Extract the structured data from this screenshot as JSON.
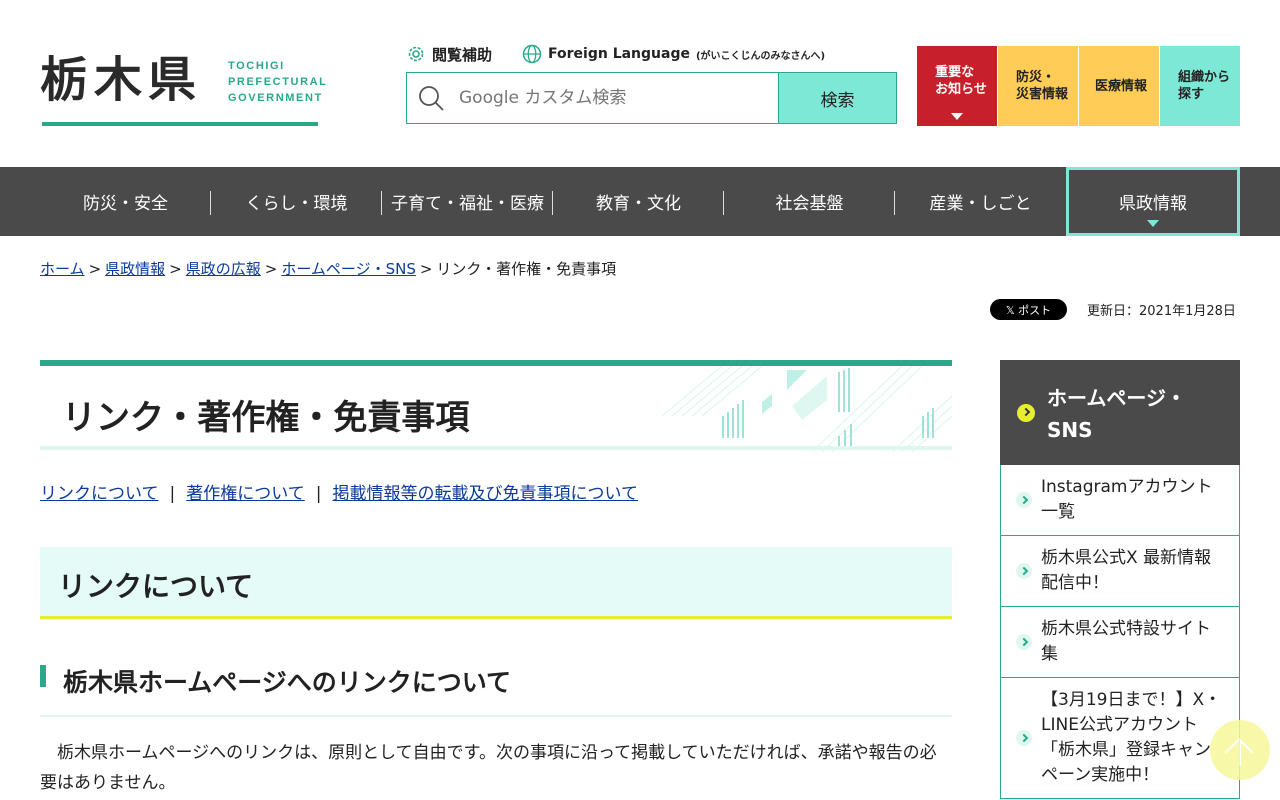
{
  "header": {
    "logo_kanji": "栃木県",
    "logo_en_lines": [
      "TOCHIGI",
      "PREFECTURAL",
      "GOVERNMENT"
    ],
    "tools": {
      "assist_label": "閲覧補助",
      "lang_label": "Foreign Language",
      "lang_sub": "(がいこくじんのみなさんへ)"
    },
    "search": {
      "placeholder": "Google カスタム検索",
      "button_label": "検索"
    },
    "quick_links": [
      {
        "label": "重要な\nお知らせ",
        "color": "#c8202a"
      },
      {
        "label": "防災・\n災害情報",
        "color": "#ffcc55"
      },
      {
        "label": "医療情報",
        "color": "#ffcc55"
      },
      {
        "label": "組織から\n探す",
        "color": "#7ee8d6"
      }
    ]
  },
  "nav": {
    "items": [
      "防災・安全",
      "くらし・環境",
      "子育て・福祉・医療",
      "教育・文化",
      "社会基盤",
      "産業・しごと",
      "県政情報"
    ],
    "active": "県政情報"
  },
  "breadcrumb": {
    "links": [
      "ホーム",
      "県政情報",
      "県政の広報",
      "ホームページ・SNS"
    ],
    "current": "リンク・著作権・免責事項",
    "separator": ">"
  },
  "share": {
    "post_label": "𝕏 ポスト",
    "updated": "更新日：2021年1月28日"
  },
  "main": {
    "title": "リンク・著作権・免責事項",
    "anchors": [
      "リンクについて",
      "著作権について",
      "掲載情報等の転載及び免責事項について"
    ],
    "anchor_separator": "|",
    "h2": "リンクについて",
    "h3": "栃木県ホームページへのリンクについて",
    "paragraph": "栃木県ホームページへのリンクは、原則として自由です。次の事項に沿って掲載していただければ、承諾や報告の必要はありません。"
  },
  "sidebar": {
    "heading": "ホームページ・\nSNS",
    "items": [
      "Instagramアカウント一覧",
      "栃木県公式X 最新情報配信中！",
      "栃木県公式特設サイト集",
      "【3月19日まで！】X・LINE公式アカウント「栃木県」登録キャンペーン実施中！"
    ]
  },
  "colors": {
    "accent": "#2aa88a",
    "accent_light": "#7ee8d6",
    "nav_bg": "#4a4a4a",
    "alert_red": "#c8202a",
    "yellow": "#ffcc55",
    "h2_bg": "#e4fbf7",
    "h2_underline": "#e7ee30"
  },
  "icons": {
    "assist": "gear-icon",
    "language": "globe-icon",
    "search": "search-icon",
    "back_to_top": "arrow-up-icon"
  }
}
